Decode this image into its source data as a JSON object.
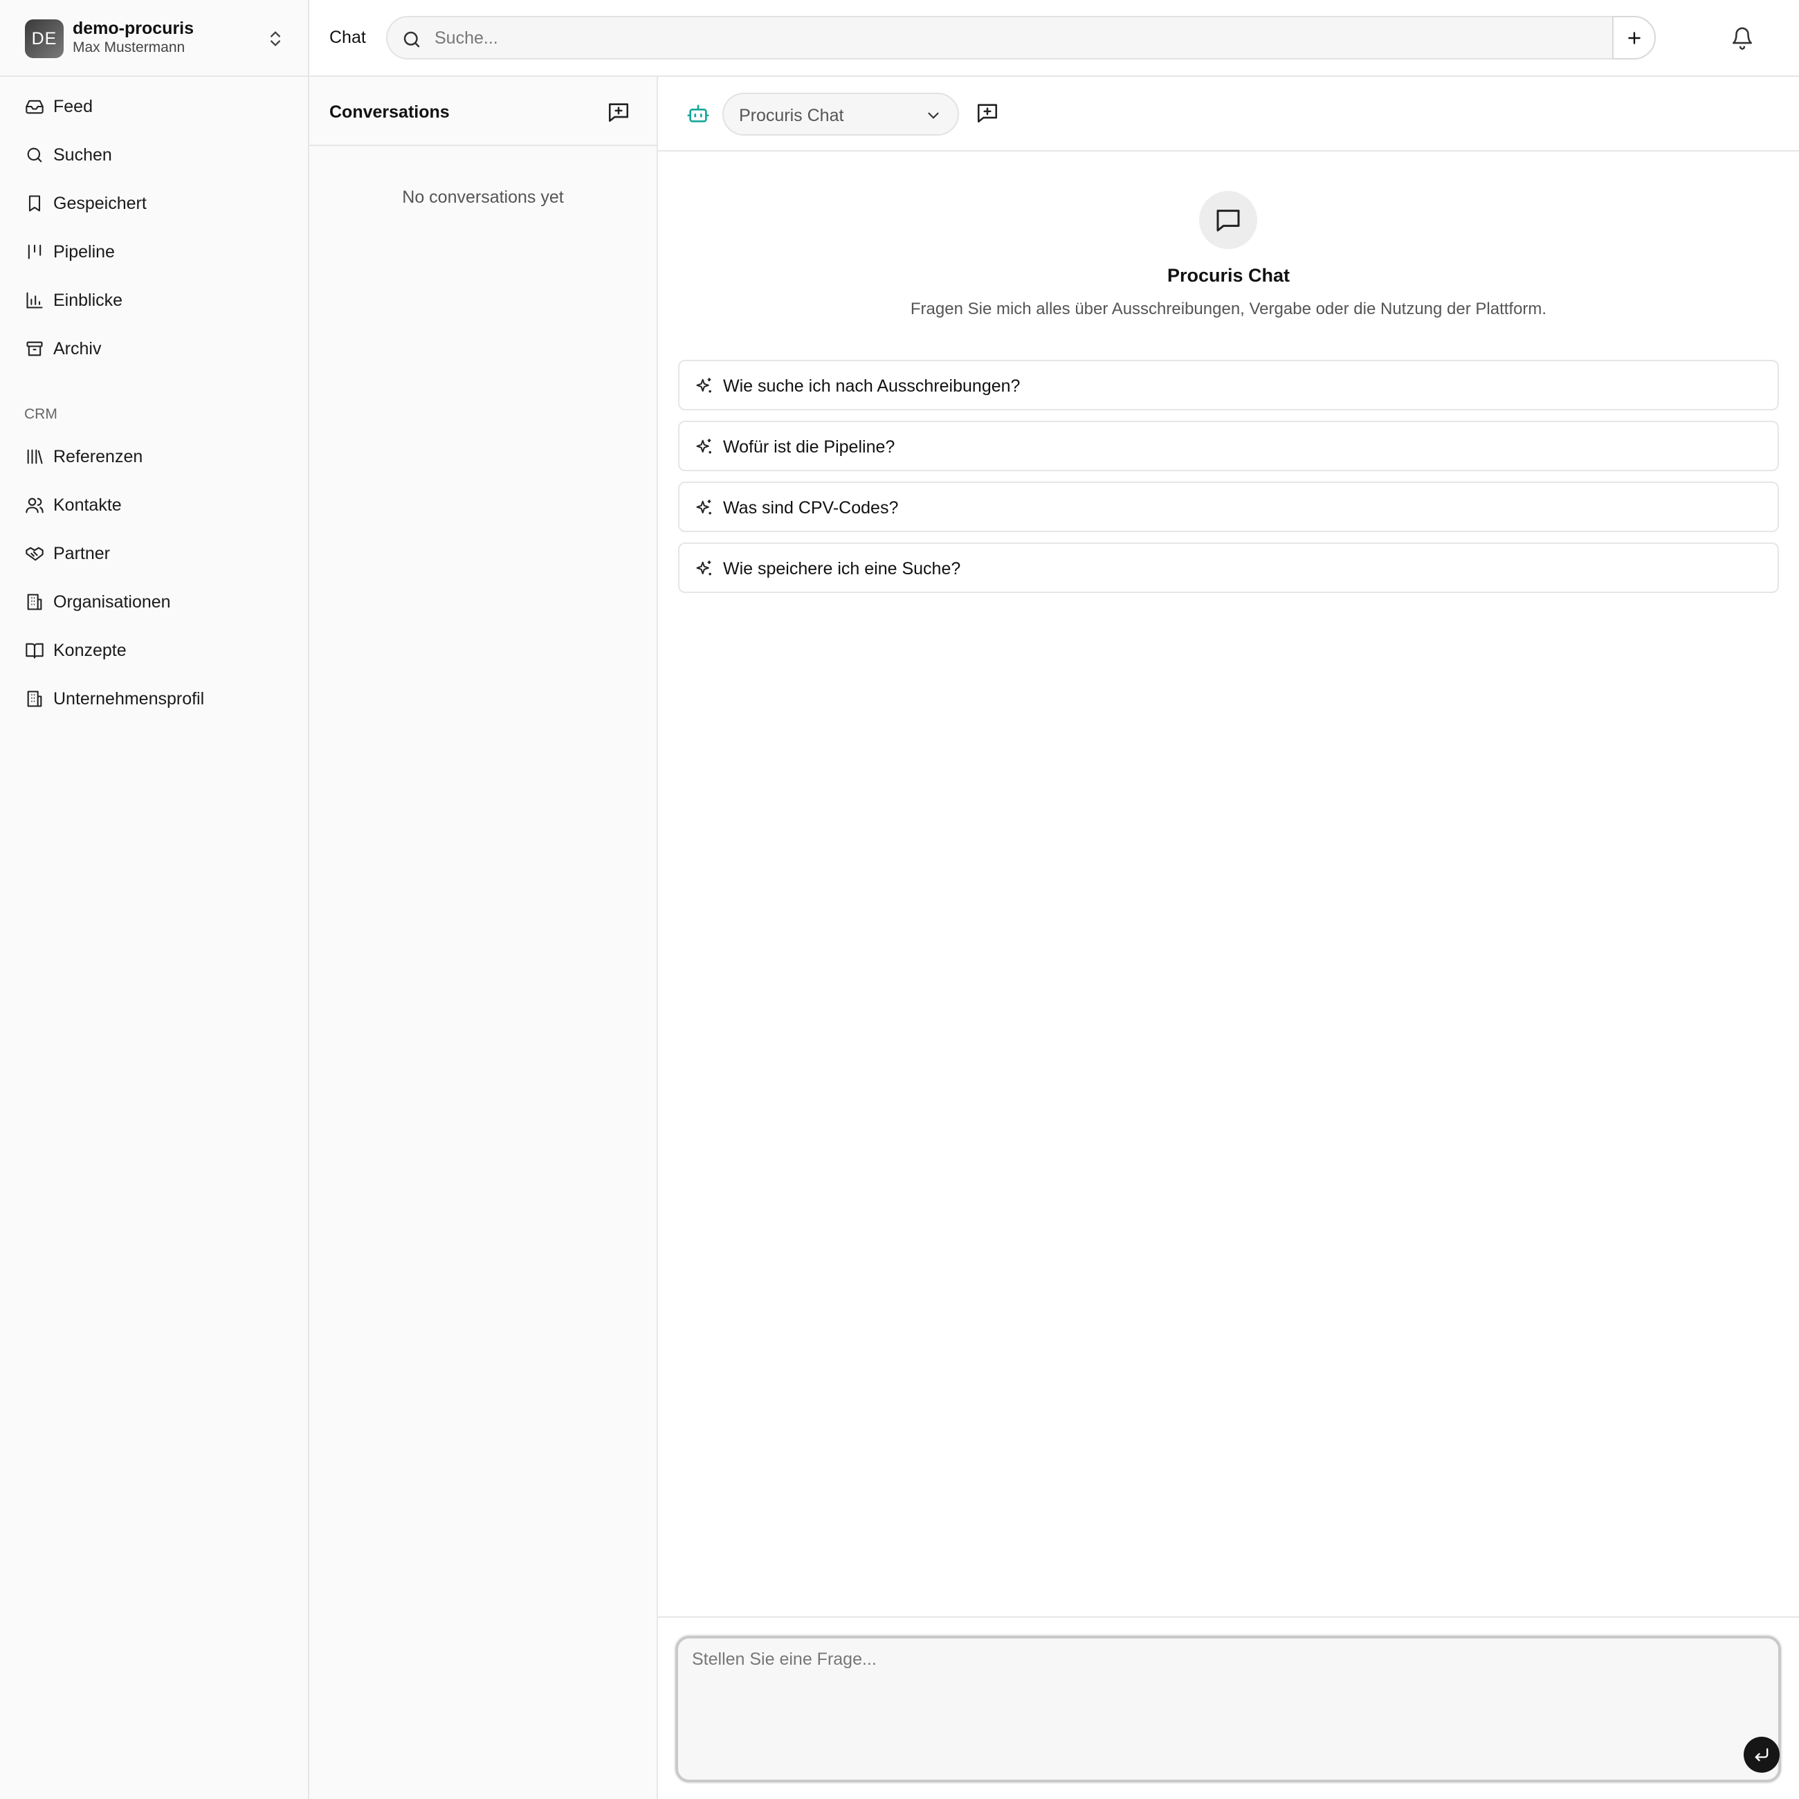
{
  "workspace": {
    "initials": "DE",
    "name": "demo-procuris",
    "user": "Max Mustermann"
  },
  "sidebar": {
    "main_items": [
      {
        "label": "Feed",
        "icon": "inbox-icon"
      },
      {
        "label": "Suchen",
        "icon": "search-icon"
      },
      {
        "label": "Gespeichert",
        "icon": "bookmark-icon"
      },
      {
        "label": "Pipeline",
        "icon": "pipeline-icon"
      },
      {
        "label": "Einblicke",
        "icon": "bar-chart-icon"
      },
      {
        "label": "Archiv",
        "icon": "archive-icon"
      }
    ],
    "section_label": "CRM",
    "crm_items": [
      {
        "label": "Referenzen",
        "icon": "library-icon"
      },
      {
        "label": "Kontakte",
        "icon": "users-icon"
      },
      {
        "label": "Partner",
        "icon": "handshake-icon"
      },
      {
        "label": "Organisationen",
        "icon": "building-icon"
      },
      {
        "label": "Konzepte",
        "icon": "book-open-icon"
      },
      {
        "label": "Unternehmensprofil",
        "icon": "building-icon"
      }
    ]
  },
  "header": {
    "title": "Chat",
    "search_placeholder": "Suche..."
  },
  "conversations": {
    "title": "Conversations",
    "empty_text": "No conversations yet"
  },
  "chat": {
    "model": "Procuris Chat",
    "hero_title": "Procuris Chat",
    "hero_subtitle": "Fragen Sie mich alles über Ausschreibungen, Vergabe oder die Nutzung der Plattform.",
    "suggestions": [
      "Wie suche ich nach Ausschreibungen?",
      "Wofür ist die Pipeline?",
      "Was sind CPV-Codes?",
      "Wie speichere ich eine Suche?"
    ],
    "input_placeholder": "Stellen Sie eine Frage..."
  },
  "colors": {
    "accent": "#14a89a",
    "send_button": "#161616",
    "sidebar_bg": "#fafafa",
    "border": "#e6e6e6"
  }
}
